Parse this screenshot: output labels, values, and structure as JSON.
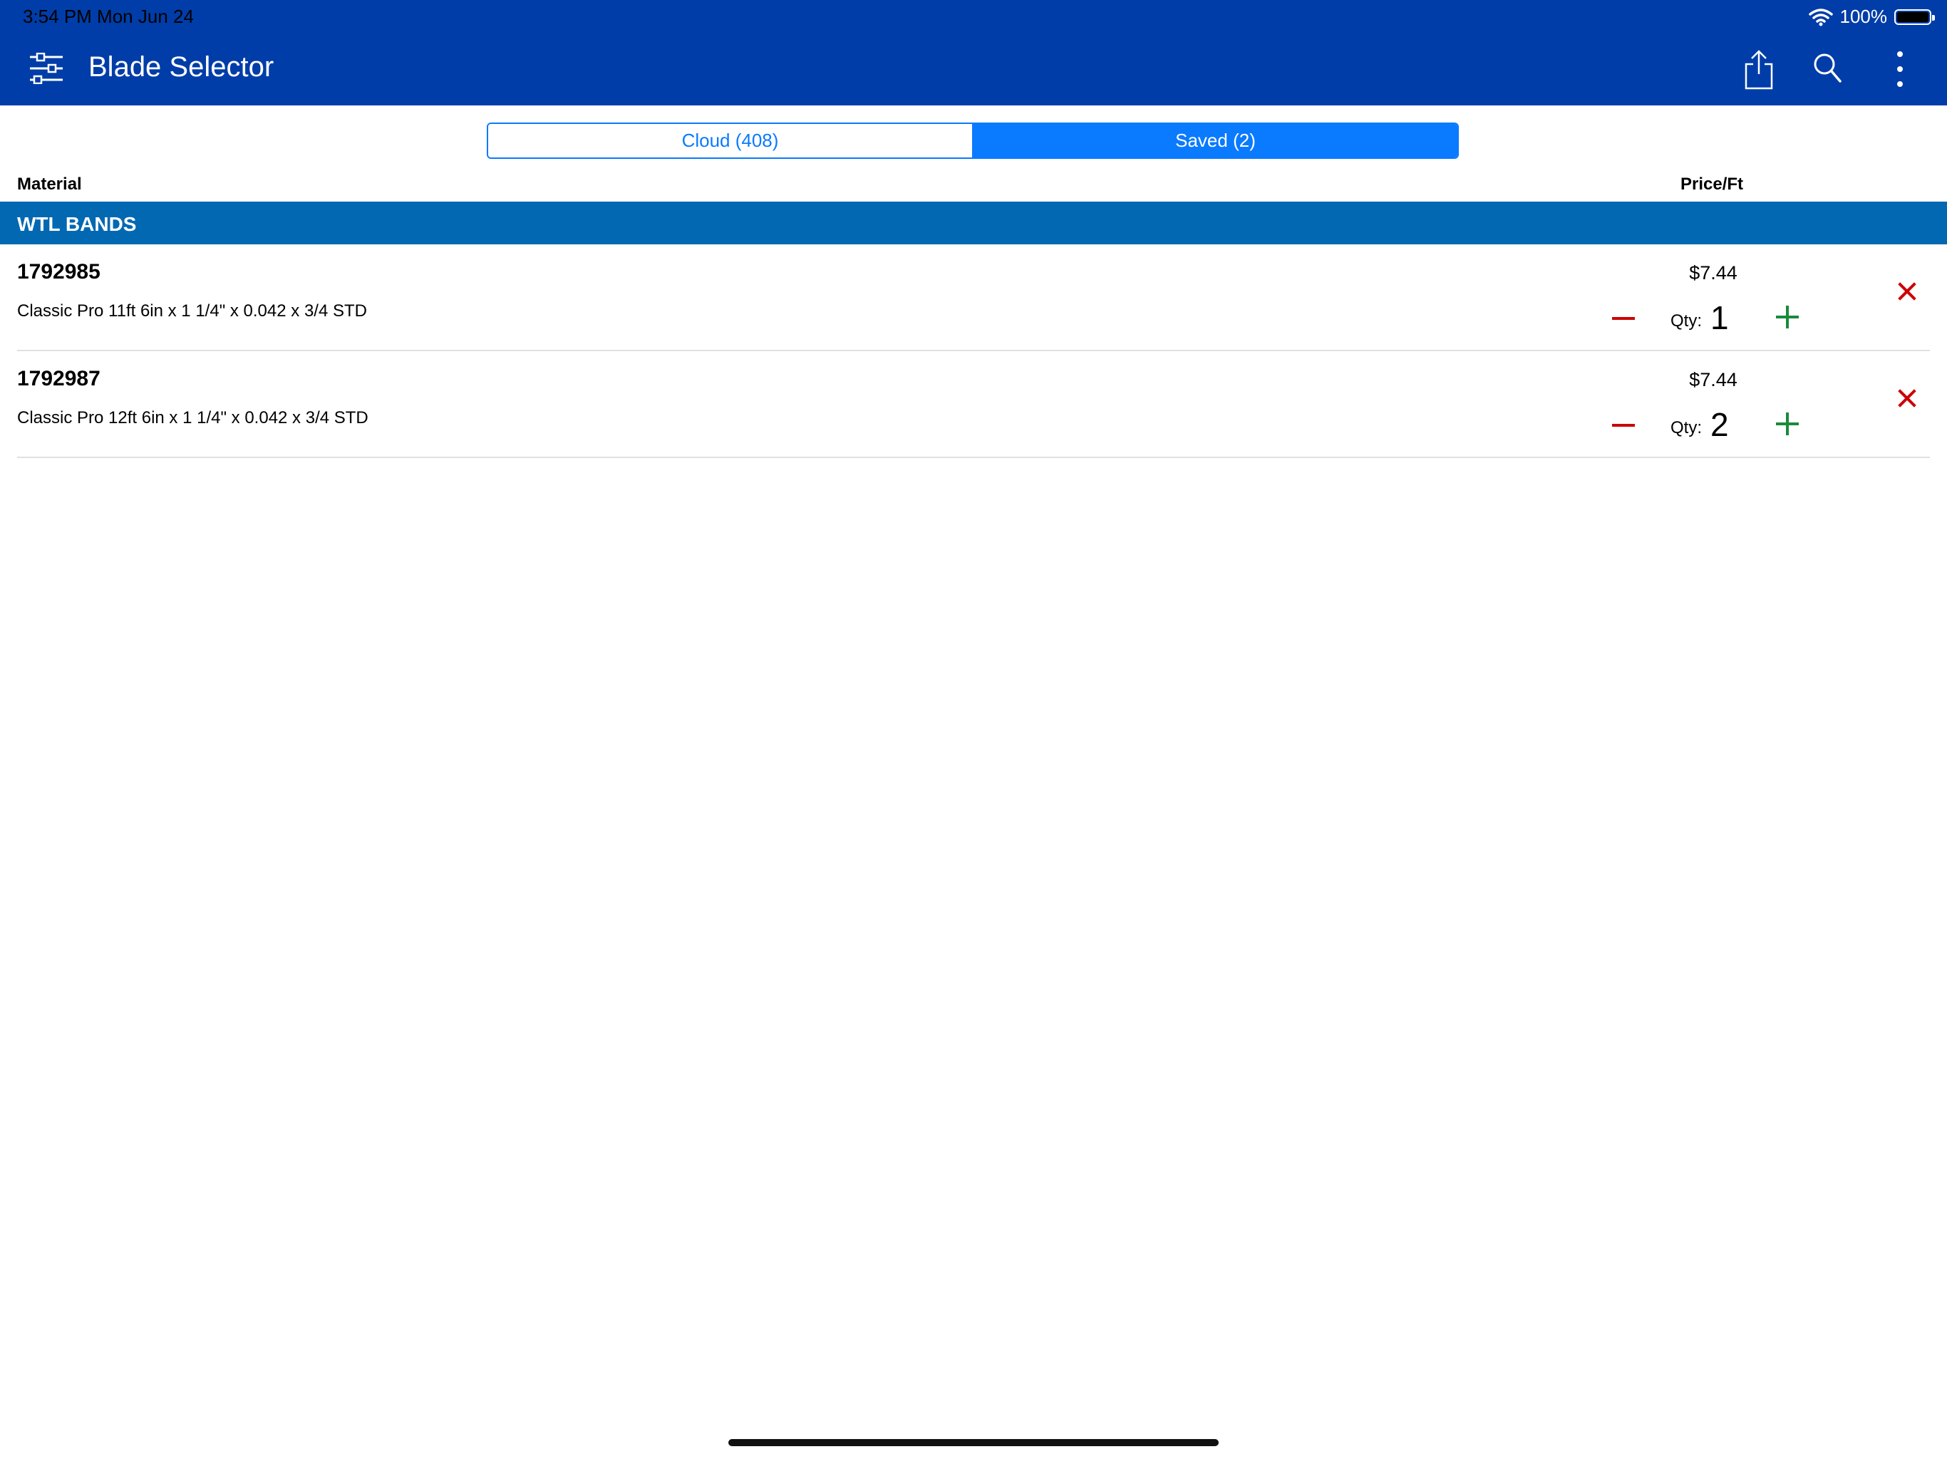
{
  "status_bar": {
    "time": "3:54 PM   Mon Jun 24",
    "battery": "100%"
  },
  "header": {
    "title": "Blade Selector"
  },
  "tabs": [
    {
      "label": "Cloud (408)",
      "active": false
    },
    {
      "label": "Saved (2)",
      "active": true
    }
  ],
  "columns": {
    "material": "Material",
    "price": "Price/Ft"
  },
  "section": {
    "title": "WTL BANDS"
  },
  "items": [
    {
      "number": "1792985",
      "description": "Classic Pro 11ft 6in x 1 1/4\" x 0.042 x 3/4 STD",
      "price": "$7.44",
      "qty_label": "Qty:",
      "qty": "1"
    },
    {
      "number": "1792987",
      "description": "Classic Pro 12ft 6in x 1 1/4\" x 0.042 x 3/4 STD",
      "price": "$7.44",
      "qty_label": "Qty:",
      "qty": "2"
    }
  ],
  "colors": {
    "nav": "#003da8",
    "accent": "#0a7aff",
    "section": "#0268b2",
    "remove": "#cc0000",
    "add": "#1a8a3c"
  },
  "icons": [
    "filter-icon",
    "share-icon",
    "search-icon",
    "more-icon",
    "wifi-icon",
    "battery-icon"
  ]
}
